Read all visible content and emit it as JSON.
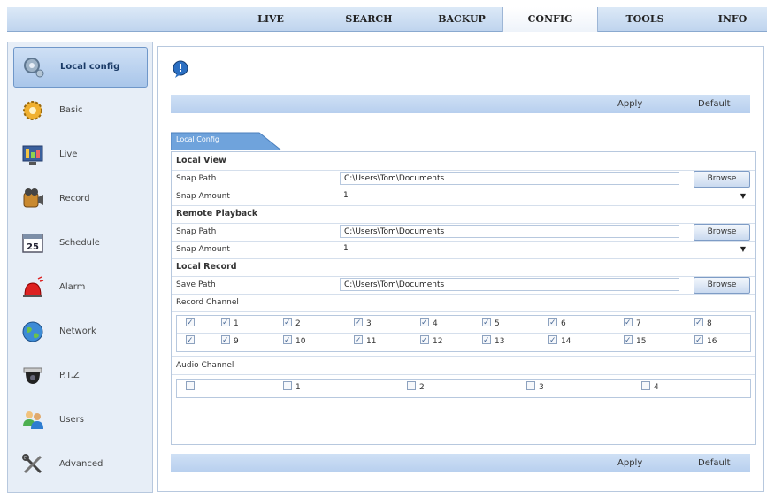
{
  "nav": {
    "tabs": [
      "LIVE",
      "SEARCH",
      "BACKUP",
      "CONFIG",
      "TOOLS",
      "INFO"
    ],
    "active": "CONFIG"
  },
  "sidebar": {
    "items": [
      {
        "label": "Local config",
        "icon": "gear-icon",
        "active": true
      },
      {
        "label": "Basic",
        "icon": "basic-gear-icon"
      },
      {
        "label": "Live",
        "icon": "live-display-icon"
      },
      {
        "label": "Record",
        "icon": "record-camera-icon"
      },
      {
        "label": "Schedule",
        "icon": "calendar-icon"
      },
      {
        "label": "Alarm",
        "icon": "alarm-siren-icon"
      },
      {
        "label": "Network",
        "icon": "globe-icon"
      },
      {
        "label": "P.T.Z",
        "icon": "ptz-dome-camera-icon"
      },
      {
        "label": "Users",
        "icon": "users-icon"
      },
      {
        "label": "Advanced",
        "icon": "tools-icon"
      }
    ]
  },
  "toolbar": {
    "apply": "Apply",
    "default": "Default"
  },
  "subtab": "Local Config",
  "local_view": {
    "title": "Local View",
    "snap_path_label": "Snap Path",
    "snap_path": "C:\\Users\\Tom\\Documents",
    "snap_amount_label": "Snap Amount",
    "snap_amount": "1",
    "browse": "Browse"
  },
  "remote_playback": {
    "title": "Remote Playback",
    "snap_path_label": "Snap Path",
    "snap_path": "C:\\Users\\Tom\\Documents",
    "snap_amount_label": "Snap Amount",
    "snap_amount": "1",
    "browse": "Browse"
  },
  "local_record": {
    "title": "Local Record",
    "save_path_label": "Save Path",
    "save_path": "C:\\Users\\Tom\\Documents",
    "browse": "Browse",
    "record_channel_label": "Record Channel",
    "record_channels_row1": [
      "1",
      "2",
      "3",
      "4",
      "5",
      "6",
      "7",
      "8"
    ],
    "record_channels_row2": [
      "9",
      "10",
      "11",
      "12",
      "13",
      "14",
      "15",
      "16"
    ],
    "record_all_checked": true,
    "audio_channel_label": "Audio Channel",
    "audio_channels": [
      "1",
      "2",
      "3",
      "4"
    ],
    "audio_all_checked": false
  },
  "colors": {
    "accent": "#6f97c9",
    "bar": "#c3d7f0"
  }
}
